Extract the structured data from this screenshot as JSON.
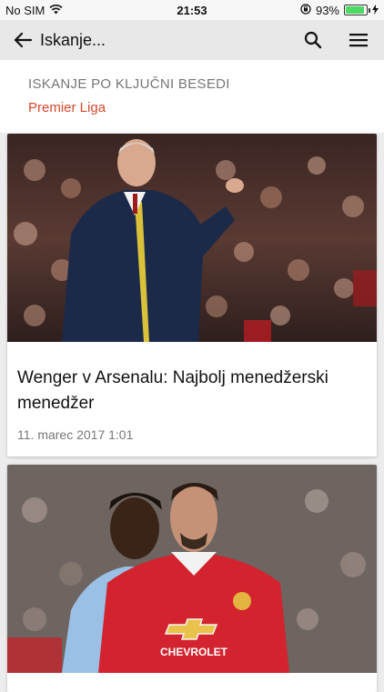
{
  "status_bar": {
    "carrier": "No SIM",
    "time": "21:53",
    "battery": "93%",
    "battery_level": 0.93
  },
  "app_bar": {
    "title": "Iskanje...",
    "back_icon": "arrow-left-icon",
    "search_icon": "search-icon",
    "menu_icon": "hamburger-menu-icon"
  },
  "search_header": {
    "label": "ISKANJE PO KLJUČNI BESEDI",
    "keyword": "Premier Liga"
  },
  "articles": [
    {
      "headline": "Wenger v Arsenalu: Najbolj menedžerski menedžer",
      "date": "11. marec 2017 1:01"
    },
    {
      "headline": "",
      "date": "",
      "image_text": "CHEVROLET"
    }
  ],
  "colors": {
    "accent": "#d9472b",
    "app_bar": "#e8e8e8",
    "background": "#ececec"
  }
}
